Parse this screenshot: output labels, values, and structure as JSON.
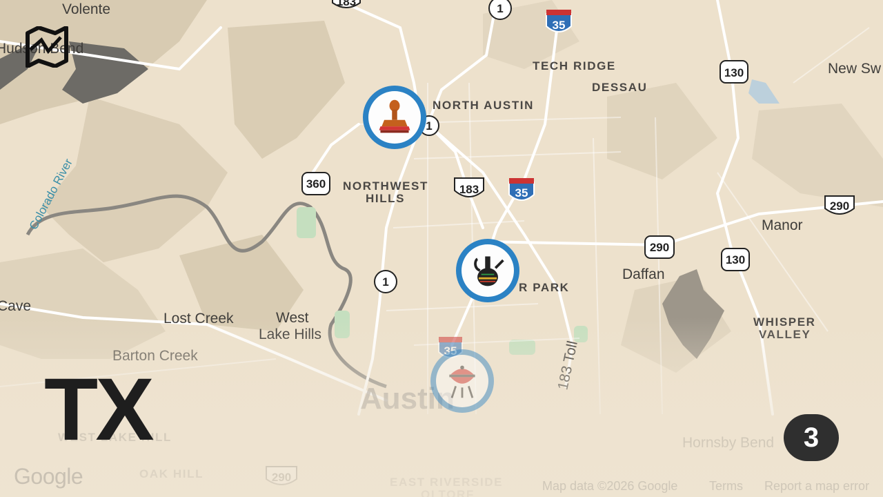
{
  "map": {
    "state_label": "TX",
    "marker_count": "3",
    "labels": {
      "volente": "Volente",
      "hudson_bend": "Hudson Bend",
      "tech_ridge": "TECH RIDGE",
      "dessau": "DESSAU",
      "north_austin": "NORTH AUSTIN",
      "new_sweden": "New Sw",
      "northwest_hills_1": "NORTHWEST",
      "northwest_hills_2": "HILLS",
      "colorado_river": "Colorado River",
      "manor": "Manor",
      "daffan": "Daffan",
      "windsor_park": "R PARK",
      "lost_creek": "Lost Creek",
      "west_lake_hills_1": "West",
      "west_lake_hills_2": "Lake Hills",
      "bee_cave": "Cave",
      "barton_creek": "Barton Creek",
      "whisper_valley_1": "WHISPER",
      "whisper_valley_2": "VALLEY",
      "austin": "Austin",
      "toll_183": "183 Toll",
      "west_lake_hills_dist": "WEST LAKE HILL",
      "oak_hill": "OAK HILL",
      "hornsby_bend": "Hornsby Bend",
      "east_riverside_1": "EAST RIVERSIDE",
      "east_riverside_2": "OLTORF"
    },
    "shields": {
      "us183_top": "183",
      "tx1_top": "1",
      "i35_top": "35",
      "tx130_top": "130",
      "tx1_north": "1",
      "tx360": "360",
      "us183_mid": "183",
      "i35_mid": "35",
      "us290_east": "290",
      "tx290_mid": "290",
      "tx130_mid": "130",
      "tx1_mid": "1",
      "i35_bottom": "35",
      "tx290_bottom": "290"
    },
    "markers": [
      {
        "name": "stamp",
        "icon": "rubber-stamp-icon"
      },
      {
        "name": "coffee pot",
        "icon": "jebena-pot-icon"
      },
      {
        "name": "grill",
        "icon": "bbq-grill-icon"
      }
    ],
    "colors": {
      "marker_ring": "#2b82c4",
      "land": "#ede1cc",
      "terrain": "#d9ccb4",
      "water": "#6d6b66"
    },
    "footer": {
      "google": "Google",
      "map_data": "Map data ©2026 Google",
      "terms": "Terms",
      "report": "Report a map error"
    }
  }
}
